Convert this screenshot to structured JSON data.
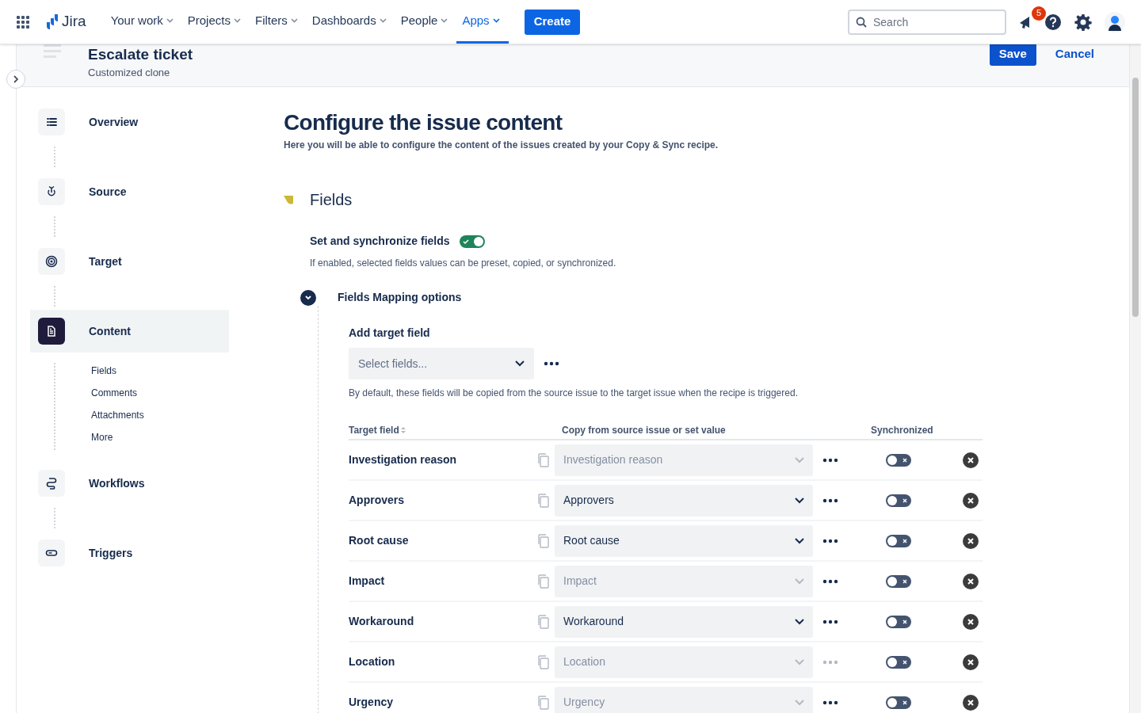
{
  "nav": {
    "items": [
      {
        "label": "Your work",
        "selected": false
      },
      {
        "label": "Projects",
        "selected": false
      },
      {
        "label": "Filters",
        "selected": false
      },
      {
        "label": "Dashboards",
        "selected": false
      },
      {
        "label": "People",
        "selected": false
      },
      {
        "label": "Apps",
        "selected": true
      }
    ],
    "logo": "Jira",
    "create": "Create",
    "search": {
      "placeholder": "Search"
    },
    "notifications": "5"
  },
  "header": {
    "title": "Escalate ticket",
    "subtitle": "Customized clone",
    "save": "Save",
    "cancel": "Cancel"
  },
  "sidebar": {
    "items": [
      {
        "label": "Overview",
        "kind": "list",
        "selected": false
      },
      {
        "label": "Source",
        "kind": "source",
        "selected": false
      },
      {
        "label": "Target",
        "kind": "target",
        "selected": false
      },
      {
        "label": "Content",
        "kind": "document",
        "selected": true,
        "children": [
          {
            "label": "Fields"
          },
          {
            "label": "Comments"
          },
          {
            "label": "Attachments"
          },
          {
            "label": "More"
          }
        ]
      },
      {
        "label": "Workflows",
        "kind": "workflow",
        "selected": false
      },
      {
        "label": "Triggers",
        "kind": "trigger",
        "selected": false
      }
    ]
  },
  "main": {
    "title": "Configure the issue content",
    "subtitle": "Here you will be able to configure the content of the issues created by your Copy & Sync recipe.",
    "section": "Fields",
    "sync_label": "Set and synchronize fields",
    "sync_on": true,
    "sync_help": "If enabled, selected fields values can be preset, copied, or synchronized.",
    "mapping_label": "Fields Mapping options",
    "mapping_expanded": true,
    "add_label": "Add target field",
    "add_placeholder": "Select fields...",
    "add_help": "By default, these fields will be copied from the source issue to the target issue when the recipe is triggered."
  },
  "table": {
    "columns": [
      "Target field",
      "Copy from source issue or set value",
      "Synchronized"
    ],
    "rows": [
      {
        "target": "Investigation reason",
        "placeholder": "Investigation reason",
        "more_disabled": false,
        "synchronized": false
      },
      {
        "target": "Approvers",
        "value": "Approvers",
        "more_disabled": false,
        "synchronized": false
      },
      {
        "target": "Root cause",
        "value": "Root cause",
        "more_disabled": false,
        "synchronized": false
      },
      {
        "target": "Impact",
        "placeholder": "Impact",
        "more_disabled": false,
        "synchronized": false
      },
      {
        "target": "Workaround",
        "value": "Workaround",
        "more_disabled": false,
        "synchronized": false
      },
      {
        "target": "Location",
        "placeholder": "Location",
        "more_disabled": true,
        "synchronized": false
      },
      {
        "target": "Urgency",
        "placeholder": "Urgency",
        "more_disabled": false,
        "synchronized": false
      }
    ]
  }
}
